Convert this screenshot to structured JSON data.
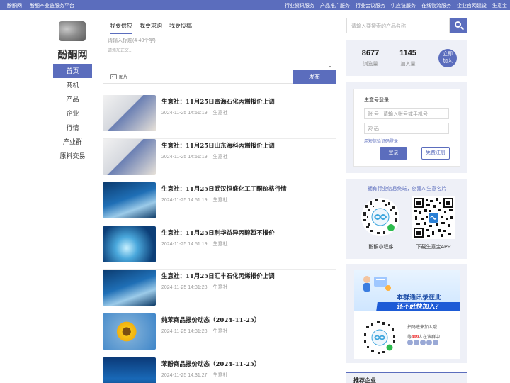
{
  "topbar": {
    "site": "酚酮网 — 酚酮产业链服务平台",
    "links": [
      "行业资讯服务",
      "产品推广服务",
      "行业会议服务",
      "供应链服务",
      "在线物流服务",
      "企业官网建设",
      "生意宝"
    ]
  },
  "brand": {
    "name": "酚酮网"
  },
  "nav": {
    "items": [
      {
        "label": "首页",
        "active": true
      },
      {
        "label": "商机",
        "active": false
      },
      {
        "label": "产品",
        "active": false
      },
      {
        "label": "企业",
        "active": false
      },
      {
        "label": "行情",
        "active": false
      },
      {
        "label": "产业群",
        "active": false
      },
      {
        "label": "原料交易",
        "active": false
      }
    ]
  },
  "post": {
    "tabs": [
      "我要供应",
      "我要求购",
      "我要投稿"
    ],
    "title_placeholder": "请输入标题(4-40个字)",
    "content_placeholder": "请添加正文...",
    "image_label": "图片",
    "publish_label": "发布"
  },
  "feed": [
    {
      "title": "生意社：11月25日富海石化丙烯报价上调",
      "time": "2024-11-25 14:51:19",
      "source": "生意社",
      "thumb": "phone"
    },
    {
      "title": "生意社：11月25日山东海科丙烯报价上调",
      "time": "2024-11-25 14:51:19",
      "source": "生意社",
      "thumb": "phone"
    },
    {
      "title": "生意社：11月25日武汉恒盛化工丁酮价格行情",
      "time": "2024-11-25 14:51:19",
      "source": "生意社",
      "thumb": "chart"
    },
    {
      "title": "生意社：11月25日利华益异丙醇暂不报价",
      "time": "2024-11-25 14:51:19",
      "source": "生意社",
      "thumb": "tech"
    },
    {
      "title": "生意社：11月25日汇丰石化丙烯报价上调",
      "time": "2024-11-25 14:31:28",
      "source": "生意社",
      "thumb": "chart"
    },
    {
      "title": "纯苯商品报价动态（2024-11-25）",
      "time": "2024-11-25 14:31:28",
      "source": "生意社",
      "thumb": "sun"
    },
    {
      "title": "苯酚商品报价动态（2024-11-25）",
      "time": "2024-11-25 14:31:27",
      "source": "生意社",
      "thumb": "blue"
    }
  ],
  "search": {
    "placeholder": "请输入要搜索的产品名称"
  },
  "stats": {
    "views": "8677",
    "views_label": "浏览量",
    "joined": "1145",
    "joined_label": "加入量",
    "join_button": [
      "立即",
      "加入"
    ]
  },
  "login": {
    "title": "生意号登录",
    "account_label": "账 号",
    "account_placeholder": "请输入账号或手机号",
    "password_label": "密 码",
    "sms_link": "用短信验证码登录",
    "login_button": "登录",
    "register_button": "免费注册"
  },
  "qr": {
    "tip": "拥有行业信息终端，创建AI生意名片",
    "mini_label": "酚酮小程序",
    "app_label": "下载生意宝APP"
  },
  "ad": {
    "headline": "本群通讯录在此",
    "subline": "还不赶快加入？",
    "scan_text": "扫码进来加入哦",
    "count_prefix": "等",
    "count": "499",
    "count_suffix": "人在该群中"
  },
  "recommend": {
    "title": "推荐企业"
  },
  "colors": {
    "accent": "#5b6dbd",
    "panel": "#eef0f7"
  }
}
